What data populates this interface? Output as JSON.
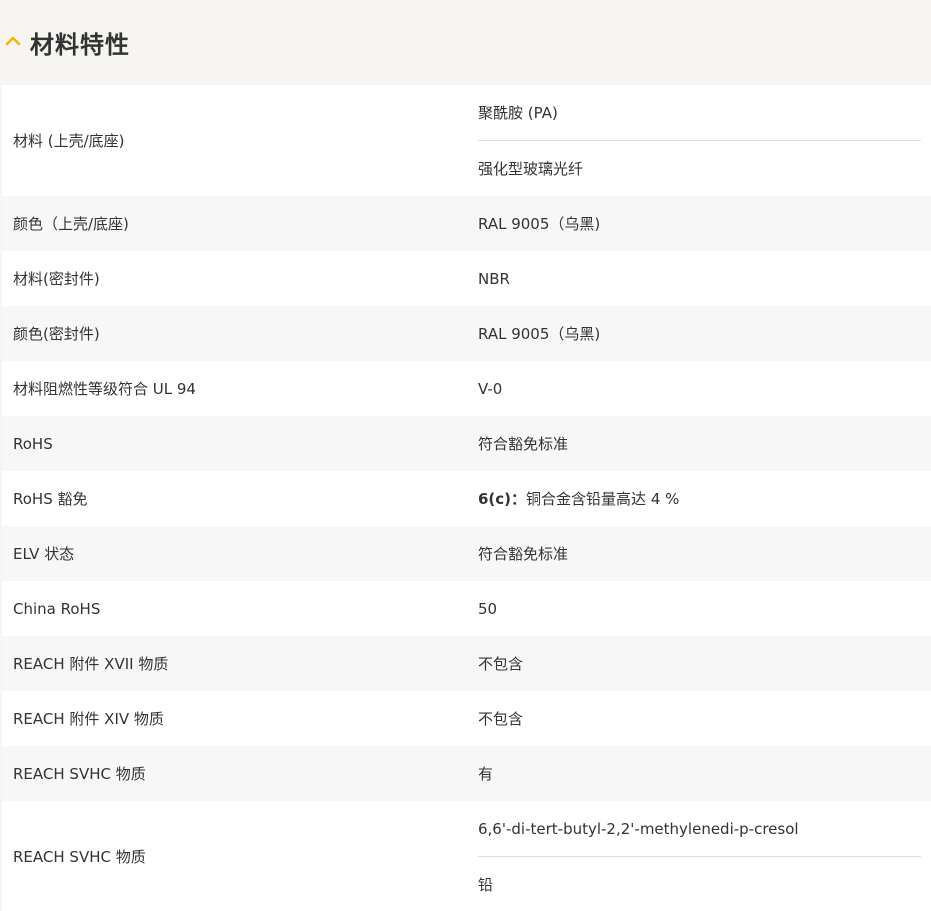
{
  "section": {
    "title": "材料特性",
    "accent_color": "#f2b705",
    "icon": "chevron-up-icon"
  },
  "rows": [
    {
      "label": "材料 (上壳/底座)",
      "values": [
        "聚酰胺 (PA)",
        "强化型玻璃光纤"
      ]
    },
    {
      "label": "颜色（上壳/底座)",
      "values": [
        "RAL 9005（乌黑)"
      ]
    },
    {
      "label": "材料(密封件)",
      "values": [
        "NBR"
      ]
    },
    {
      "label": "颜色(密封件)",
      "values": [
        "RAL 9005（乌黑)"
      ]
    },
    {
      "label": "材料阻燃性等级符合 UL 94",
      "values": [
        "V-0"
      ]
    },
    {
      "label": "RoHS",
      "values": [
        "符合豁免标准"
      ]
    },
    {
      "label": "RoHS 豁免",
      "values": [],
      "value_prefix": "6(c)：",
      "value_rest": "铜合金含铅量高达 4 %"
    },
    {
      "label": "ELV 状态",
      "values": [
        "符合豁免标准"
      ]
    },
    {
      "label": "China RoHS",
      "values": [
        "50"
      ]
    },
    {
      "label": "REACH 附件 XVII 物质",
      "values": [
        "不包含"
      ]
    },
    {
      "label": "REACH 附件 XIV 物质",
      "values": [
        "不包含"
      ]
    },
    {
      "label": "REACH SVHC 物质",
      "values": [
        "有"
      ]
    },
    {
      "label": "REACH SVHC 物质",
      "values": [
        "6,6'-di-tert-butyl-2,2'-methylenedi-p-cresol",
        "铅"
      ]
    }
  ]
}
